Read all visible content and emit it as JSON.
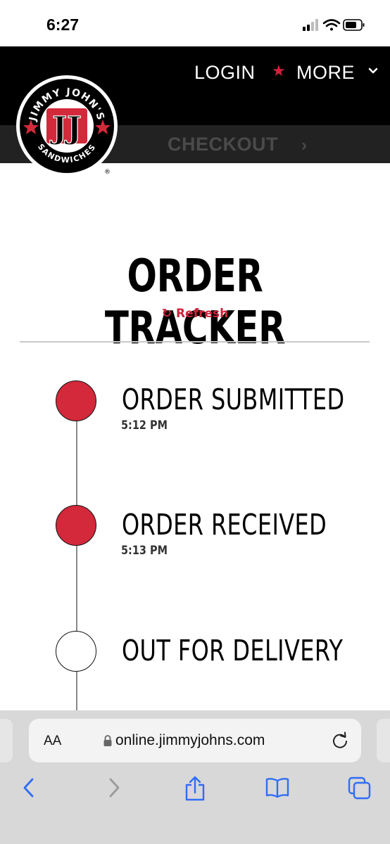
{
  "status_bar": {
    "time": "6:27"
  },
  "header": {
    "login_label": "LOGIN",
    "separator": "★",
    "more_label": "MORE",
    "checkout_label": "CHECKOUT",
    "checkout_chevron": "›",
    "logo": {
      "brand_top": "JIMMY JOHN'S",
      "brand_bottom": "SANDWICHES",
      "monogram": "JJ",
      "registered": "®"
    }
  },
  "tracker": {
    "title": "ORDER TRACKER",
    "refresh_icon": "↻",
    "refresh_label": "Refresh",
    "steps": [
      {
        "label": "ORDER SUBMITTED",
        "time": "5:12 PM",
        "completed": true
      },
      {
        "label": "ORDER RECEIVED",
        "time": "5:13 PM",
        "completed": true
      },
      {
        "label": "OUT FOR DELIVERY",
        "time": "",
        "completed": false
      }
    ]
  },
  "browser": {
    "text_size_label": "AA",
    "url": "online.jimmyjohns.com"
  },
  "colors": {
    "brand_red": "#d0223a",
    "step_complete": "#d3293b",
    "header_bg": "#000000",
    "subbar_bg": "#222222"
  },
  "icons": [
    "signal-icon",
    "wifi-icon",
    "battery-icon",
    "star-icon",
    "chevron-down-icon",
    "refresh-icon",
    "lock-icon",
    "reload-icon",
    "back-icon",
    "forward-icon",
    "share-icon",
    "bookmarks-icon",
    "tabs-icon"
  ]
}
